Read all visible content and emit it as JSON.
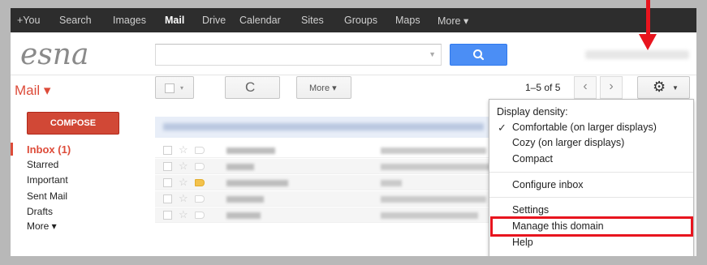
{
  "topnav": [
    "+You",
    "Search",
    "Images",
    "Mail",
    "Drive",
    "Calendar",
    "Sites",
    "Groups",
    "Maps",
    "More ▾"
  ],
  "brand": {
    "logo_text": "esna"
  },
  "search": {
    "placeholder": "",
    "button_icon": "search-icon"
  },
  "header": {
    "mail_label": "Mail ▾"
  },
  "toolbar": {
    "select_caret": "▾",
    "refresh_icon": "C",
    "more_label": "More ▾",
    "pager_text": "1–5 of 5",
    "prev_icon": "‹",
    "next_icon": "›",
    "settings_icon": "gear-icon"
  },
  "sidebar": {
    "compose_label": "COMPOSE",
    "items": [
      "Inbox (1)",
      "Starred",
      "Important",
      "Sent Mail",
      "Drafts",
      "More ▾"
    ]
  },
  "messages": {
    "count": 5,
    "flagged_row": 3
  },
  "settings_menu": {
    "header": "Display density:",
    "checkmark": "✓",
    "items": [
      "Comfortable (on larger displays)",
      "Cozy (on larger displays)",
      "Compact",
      "Configure inbox",
      "Settings",
      "Manage this domain",
      "Help"
    ],
    "selected_density": "Comfortable (on larger displays)",
    "highlighted_item": "Manage this domain"
  },
  "colors": {
    "accent_red": "#dd4b39",
    "compose_bg": "#d14836",
    "search_blue": "#4b8ef5",
    "annotation_red": "#e8141e"
  }
}
